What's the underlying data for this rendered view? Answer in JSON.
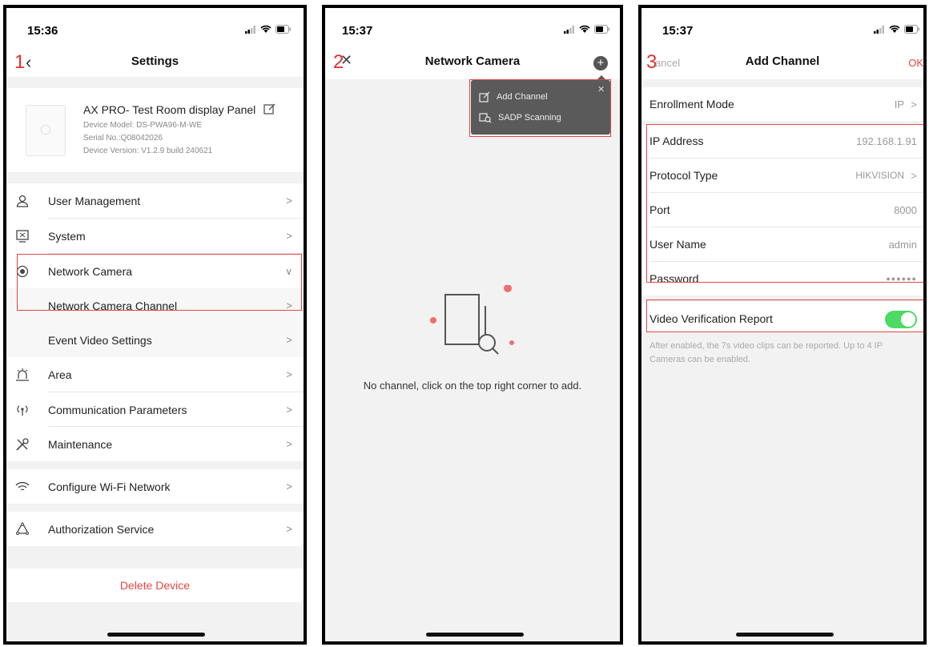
{
  "screen1": {
    "step": "1",
    "time": "15:36",
    "title": "Settings",
    "device": {
      "name": "AX PRO- Test Room display Panel",
      "model": "Device Model: DS-PWA96-M-WE",
      "serial": "Serial No.:Q08042026",
      "version": "Device Version: V1.2.9 build 240621"
    },
    "items": [
      {
        "label": "User Management",
        "icon": "user-icon"
      },
      {
        "label": "System",
        "icon": "system-icon"
      },
      {
        "label": "Network Camera",
        "icon": "camera-icon"
      },
      {
        "label": "Network Camera Channel"
      },
      {
        "label": "Event Video Settings"
      },
      {
        "label": "Area",
        "icon": "area-icon"
      },
      {
        "label": "Communication Parameters",
        "icon": "antenna-icon"
      },
      {
        "label": "Maintenance",
        "icon": "tools-icon"
      },
      {
        "label": "Configure Wi-Fi Network",
        "icon": "wifi-icon"
      },
      {
        "label": "Authorization Service",
        "icon": "authorization-icon"
      }
    ],
    "delete_label": "Delete Device",
    "accent": "#e64545"
  },
  "screen2": {
    "step": "2",
    "time": "15:37",
    "title": "Network Camera",
    "menu": {
      "add_channel": "Add Channel",
      "sadp": "SADP Scanning"
    },
    "empty_text": "No channel, click on the top right corner to add."
  },
  "screen3": {
    "step": "3",
    "time": "15:37",
    "cancel": "ancel",
    "title": "Add Channel",
    "ok": "OK",
    "enrollment": {
      "label": "Enrollment Mode",
      "value": "IP"
    },
    "fields": [
      {
        "label": "IP Address",
        "value": "192.168.1.91"
      },
      {
        "label": "Protocol Type",
        "value": "HIKVISION"
      },
      {
        "label": "Port",
        "value": "8000"
      },
      {
        "label": "User Name",
        "value": "admin"
      },
      {
        "label": "Password",
        "value": "●●●●●●"
      }
    ],
    "video_report": {
      "label": "Video Verification Report",
      "enabled": true
    },
    "hint": "After enabled, the 7s video clips can be reported. Up to 4 IP Cameras can be enabled.",
    "toggle_color": "#4cd964"
  }
}
